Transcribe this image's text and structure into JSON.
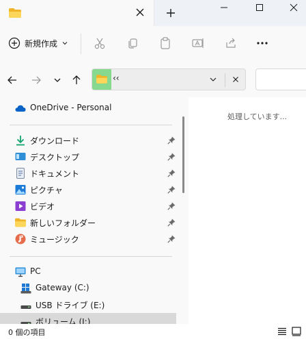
{
  "tab": {
    "title": ""
  },
  "window": {
    "minimize": "minimize",
    "maximize": "maximize"
  },
  "toolbar": {
    "new_label": "新規作成",
    "icons": [
      "cut-icon",
      "copy-icon",
      "paste-icon",
      "rename-icon",
      "share-icon",
      "more-icon"
    ]
  },
  "address": {
    "path": "‹‹"
  },
  "sidebar": {
    "onedrive": "OneDrive - Personal",
    "quick": [
      {
        "label": "ダウンロード",
        "icon": "download-icon"
      },
      {
        "label": "デスクトップ",
        "icon": "desktop-icon"
      },
      {
        "label": "ドキュメント",
        "icon": "document-icon"
      },
      {
        "label": "ピクチャ",
        "icon": "pictures-icon"
      },
      {
        "label": "ビデオ",
        "icon": "video-icon"
      },
      {
        "label": "新しいフォルダー",
        "icon": "folder-icon"
      },
      {
        "label": "ミュージック",
        "icon": "music-icon"
      }
    ],
    "pc": "PC",
    "drives": [
      {
        "label": "Gateway (C:)",
        "icon": "windows-drive-icon"
      },
      {
        "label": "USB ドライブ (E:)",
        "icon": "usb-drive-icon"
      },
      {
        "label": "ボリューム (I:)",
        "icon": "drive-icon"
      }
    ]
  },
  "main": {
    "status": "処理しています..."
  },
  "statusbar": {
    "count": "0 個の項目"
  },
  "colors": {
    "accent": "#0067c0",
    "folder": "#f7c948",
    "selected": "#d9d9d9"
  }
}
